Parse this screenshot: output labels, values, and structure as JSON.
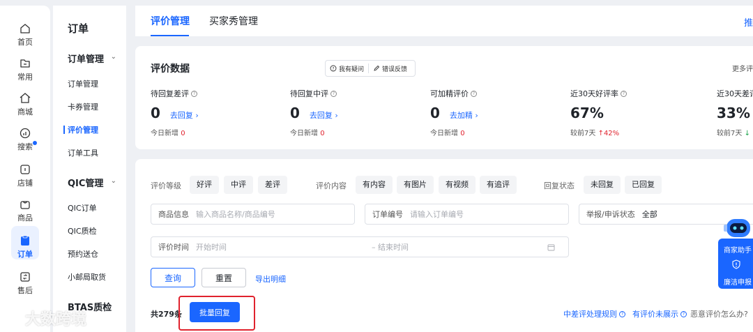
{
  "rail": [
    {
      "label": "首页",
      "icon": "home-icon"
    },
    {
      "label": "常用",
      "icon": "folder-icon"
    },
    {
      "label": "商城",
      "icon": "mall-icon"
    },
    {
      "label": "搜索",
      "icon": "search-chart-icon"
    },
    {
      "label": "店铺",
      "icon": "store-icon"
    },
    {
      "label": "商品",
      "icon": "bag-icon"
    },
    {
      "label": "订单",
      "icon": "order-icon"
    },
    {
      "label": "售后",
      "icon": "after-sale-icon"
    }
  ],
  "subnav": {
    "title": "订单",
    "group1": "订单管理",
    "group1_items": [
      "订单管理",
      "卡券管理",
      "评价管理",
      "订单工具"
    ],
    "group2": "QIC管理",
    "group2_items": [
      "QIC订单",
      "QIC质检",
      "预约送仓",
      "小邮局取货"
    ],
    "group3": "BTAS质检"
  },
  "tabs": {
    "items": [
      "评价管理",
      "买家秀管理"
    ],
    "edge": "推"
  },
  "stats": {
    "title": "评价数据",
    "help": "我有疑问",
    "feedback": "错误反馈",
    "more": "更多评",
    "metrics": [
      {
        "label": "待回复差评",
        "value": "0",
        "link": "去回复 ›",
        "sub_label": "今日新增",
        "sub_value": "0"
      },
      {
        "label": "待回复中评",
        "value": "0",
        "link": "去回复 ›",
        "sub_label": "今日新增",
        "sub_value": "0"
      },
      {
        "label": "可加精评价",
        "value": "0",
        "link": "去加精 ›",
        "sub_label": "今日新增",
        "sub_value": "0"
      },
      {
        "label": "近30天好评率",
        "value": "67%",
        "link": "",
        "sub_label": "较前7天",
        "sub_value": "↑42%"
      },
      {
        "label": "近30天差评",
        "value": "33%",
        "link": "",
        "sub_label": "较前7天",
        "sub_value": "↓"
      }
    ]
  },
  "filter": {
    "level_label": "评价等级",
    "levels": [
      "好评",
      "中评",
      "差评"
    ],
    "content_label": "评价内容",
    "contents": [
      "有内容",
      "有图片",
      "有视频",
      "有追评"
    ],
    "reply_label": "回复状态",
    "replies": [
      "未回复",
      "已回复"
    ],
    "product_label": "商品信息",
    "product_placeholder": "输入商品名称/商品编号",
    "order_label": "订单编号",
    "order_placeholder": "请输入订单编号",
    "report_label": "举报/申诉状态",
    "report_value": "全部",
    "time_label": "评价时间",
    "start_placeholder": "开始时间",
    "end_placeholder": "– 结束时间",
    "query": "查询",
    "reset": "重置",
    "export": "导出明细",
    "count": "共279条",
    "batch": "批量回复",
    "rule_link": "中差评处理规则",
    "hidden_link": "有评价未展示",
    "malicious_link": "恶意评价怎么办?"
  },
  "assistant": {
    "title": "商家助手",
    "report": "廉洁申报"
  },
  "watermark": "大数跨境",
  "colors": {
    "accent": "#1a66ff",
    "danger": "#e0222d",
    "page_bg": "#eef0f4"
  }
}
